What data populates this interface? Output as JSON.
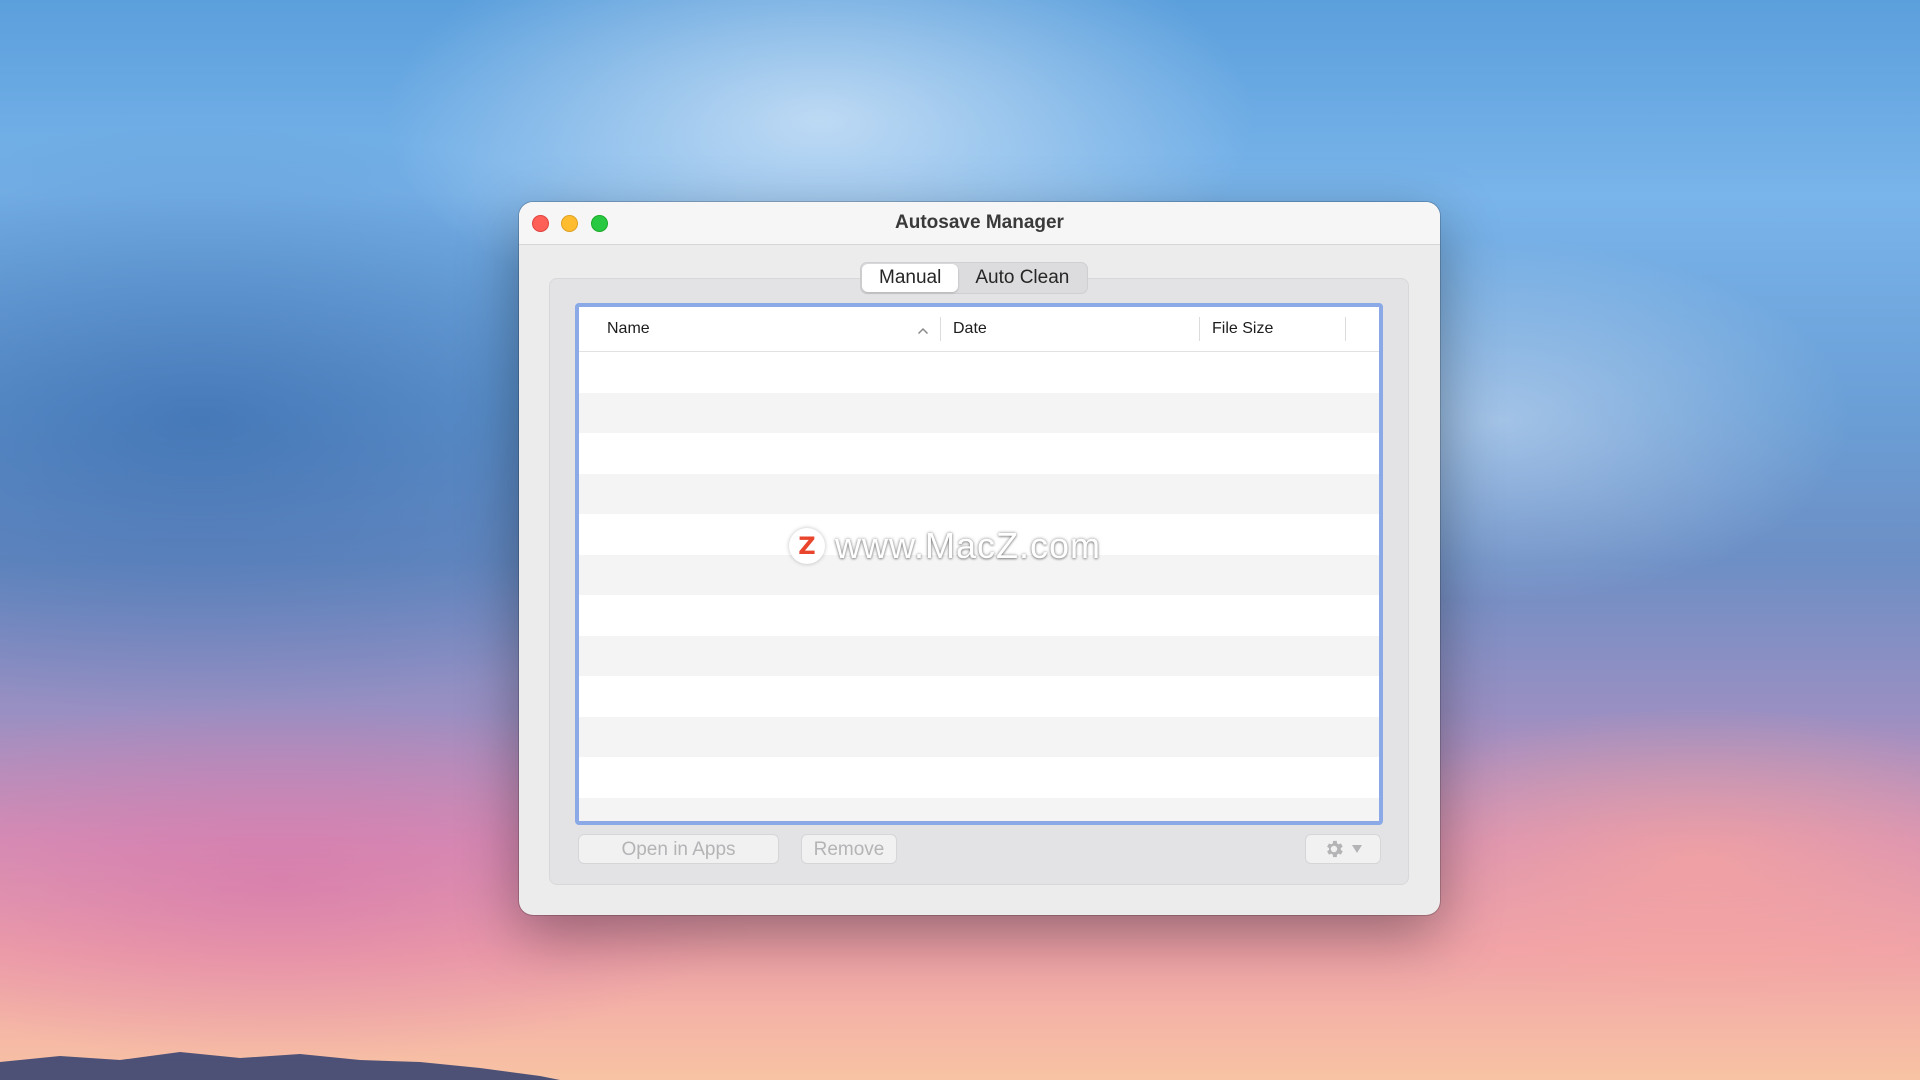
{
  "window": {
    "title": "Autosave Manager"
  },
  "tabs": [
    {
      "label": "Manual",
      "selected": true
    },
    {
      "label": "Auto Clean",
      "selected": false
    }
  ],
  "table": {
    "columns": [
      {
        "label": "Name",
        "sort": "ascending"
      },
      {
        "label": "Date"
      },
      {
        "label": "File Size"
      }
    ],
    "rows": []
  },
  "watermark": {
    "logo_letter": "Z",
    "text": "www.MacZ.com"
  },
  "buttons": {
    "open_in_apps": "Open in Apps",
    "remove": "Remove",
    "actions_icon": "gear-icon"
  },
  "colors": {
    "close": "#fe5f57",
    "minimize": "#febc2e",
    "zoom": "#28c840",
    "focus_ring": "#8aa9e6"
  }
}
